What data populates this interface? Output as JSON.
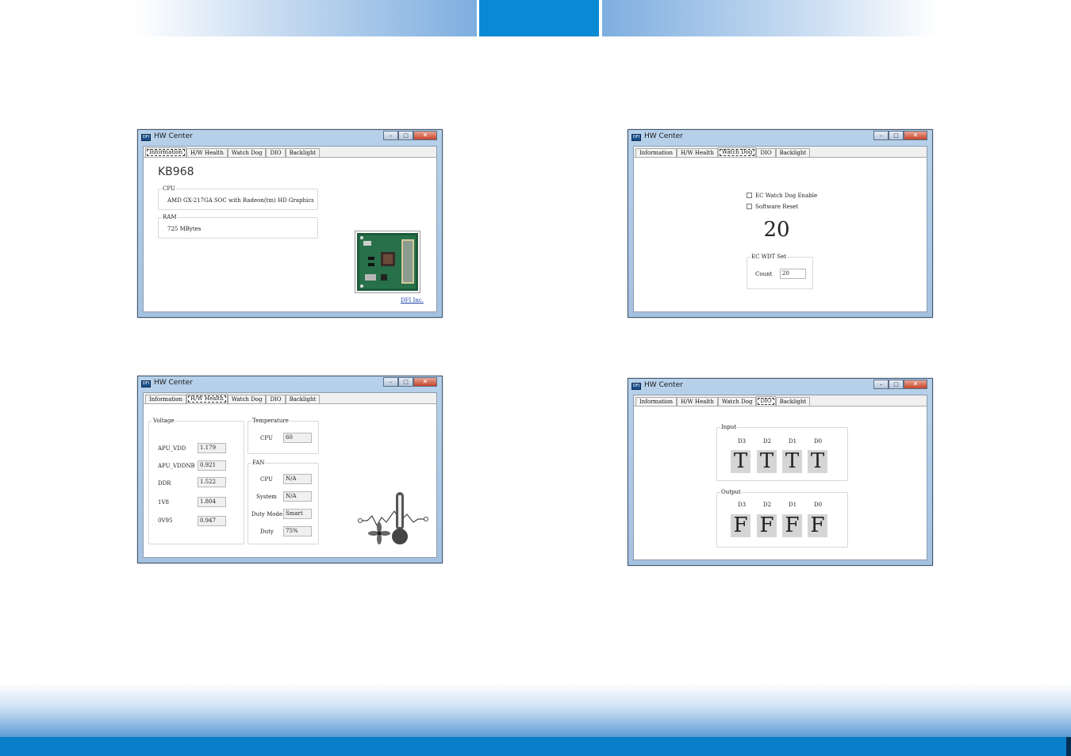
{
  "windows": [
    {
      "title": "HW Center",
      "tabs": [
        "Information",
        "H/W Health",
        "Watch Dog",
        "DIO",
        "Backlight"
      ],
      "active_tab": 0,
      "model": "KB968",
      "cpu_label": "CPU",
      "cpu_value": "AMD GX-217GA SOC with Radeon(tm) HD Graphics",
      "ram_label": "RAM",
      "ram_value": "725 MBytes",
      "link": "DFI Inc."
    },
    {
      "title": "HW Center",
      "tabs": [
        "Information",
        "H/W Health",
        "Watch Dog",
        "DIO",
        "Backlight"
      ],
      "active_tab": 2,
      "ec_enable": "EC Watch Dog Enable",
      "software_reset": "Software Reset",
      "countdown": "20",
      "wdt_group": "EC WDT Set",
      "count_label": "Count",
      "count_value": "20"
    },
    {
      "title": "HW Center",
      "tabs": [
        "Information",
        "H/W Health",
        "Watch Dog",
        "DIO",
        "Backlight"
      ],
      "active_tab": 1,
      "voltage_group": "Voltage",
      "voltages": [
        {
          "label": "APU_VDD",
          "value": "1.179"
        },
        {
          "label": "APU_VDDNB",
          "value": "0.921"
        },
        {
          "label": "DDR",
          "value": "1.522"
        },
        {
          "label": "1V8",
          "value": "1.804"
        },
        {
          "label": "0V95",
          "value": "0.947"
        }
      ],
      "temperature_group": "Temperature",
      "temp_label": "CPU",
      "temp_value": "60",
      "fan_group": "FAN",
      "fan": [
        {
          "label": "CPU",
          "value": "N/A"
        },
        {
          "label": "System",
          "value": "N/A"
        },
        {
          "label": "Duty Mode",
          "value": "Smart"
        },
        {
          "label": "Duty",
          "value": "75%"
        }
      ]
    },
    {
      "title": "HW Center",
      "tabs": [
        "Information",
        "H/W Health",
        "Watch Dog",
        "DIO",
        "Backlight"
      ],
      "active_tab": 3,
      "input_group": "Input",
      "input_pins": [
        "D3",
        "D2",
        "D1",
        "D0"
      ],
      "input_values": [
        "T",
        "T",
        "T",
        "T"
      ],
      "output_group": "Output",
      "output_pins": [
        "D3",
        "D2",
        "D1",
        "D0"
      ],
      "output_values": [
        "F",
        "F",
        "F",
        "F"
      ]
    }
  ],
  "colors": {
    "header_blue": "#0a8ad4",
    "footer_blue": "#0a7fc9",
    "window_frame": "#a4c2e0"
  }
}
